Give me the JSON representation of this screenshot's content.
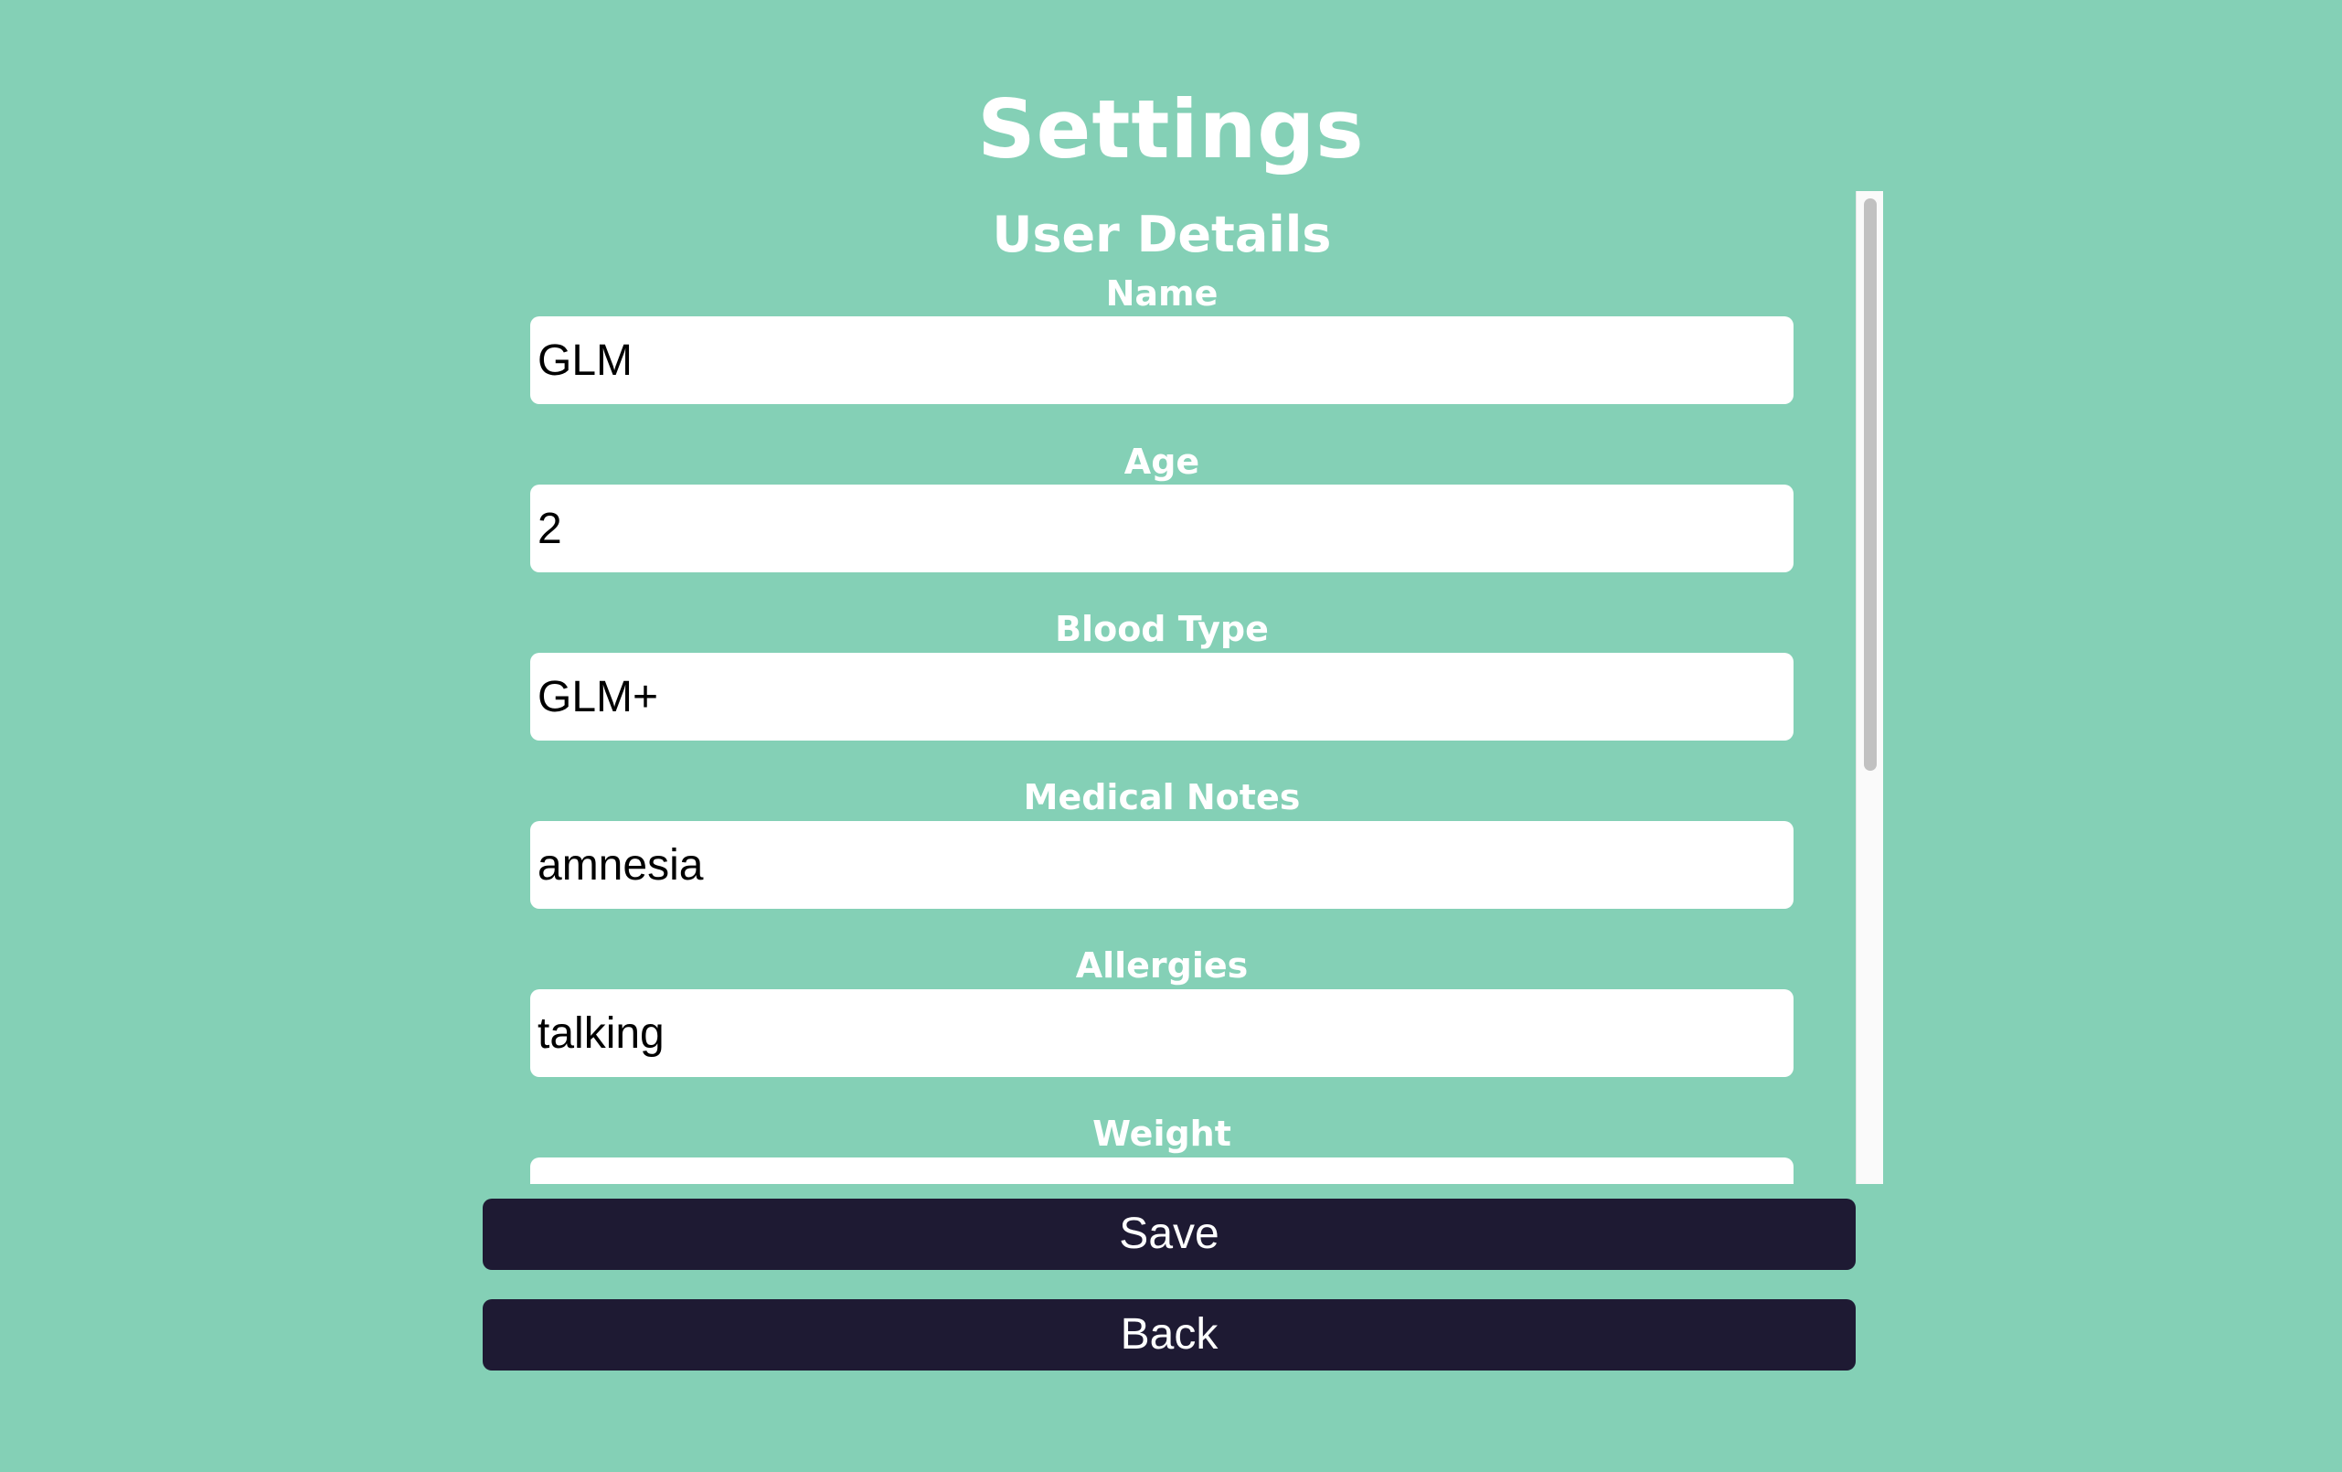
{
  "page": {
    "title": "Settings"
  },
  "user_details": {
    "heading": "User Details",
    "fields": [
      {
        "label": "Name",
        "value": "GLM"
      },
      {
        "label": "Age",
        "value": "2"
      },
      {
        "label": "Blood Type",
        "value": "GLM+"
      },
      {
        "label": "Medical Notes",
        "value": "amnesia"
      },
      {
        "label": "Allergies",
        "value": "talking"
      },
      {
        "label": "Weight",
        "value": ""
      }
    ]
  },
  "actions": {
    "save_label": "Save",
    "back_label": "Back"
  },
  "colors": {
    "background": "#84d0b6",
    "button": "#1e1a33",
    "text_light": "#ffffff"
  }
}
